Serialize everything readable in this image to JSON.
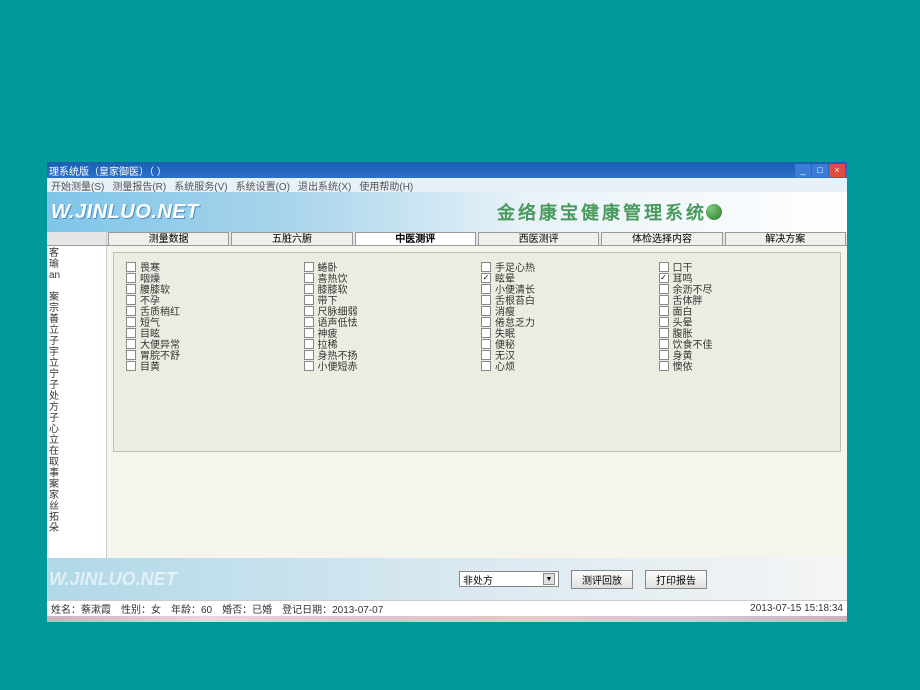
{
  "titlebar": {
    "title": "理系统版（皇家御医）（  ）"
  },
  "menubar": {
    "items": [
      "开始测量(S)",
      "测量报告(R)",
      "系统服务(V)",
      "系统设置(O)",
      "退出系统(X)",
      "使用帮助(H)"
    ]
  },
  "banner": {
    "url": "W.JINLUO.NET",
    "title": "金络康宝健康管理系统"
  },
  "tabs": {
    "items": [
      {
        "label": "测量数据",
        "active": false
      },
      {
        "label": "五脏六腑",
        "active": false
      },
      {
        "label": "中医测评",
        "active": true
      },
      {
        "label": "西医测评",
        "active": false
      },
      {
        "label": "体检选择内容",
        "active": false
      },
      {
        "label": "解决方案",
        "active": false
      }
    ]
  },
  "sidebar": {
    "text": "客\n瑜\nan\n\n案\n宗\n善\n立\n子\n宇\n立\n宁\n子\n处\n方\n子\n心\n立\n在\n取\n事\n案\n家\n丝\n拓\n朵"
  },
  "symptoms": {
    "col1": [
      {
        "label": "畏寒",
        "checked": false
      },
      {
        "label": "咽燥",
        "checked": false
      },
      {
        "label": "腰膝软",
        "checked": false
      },
      {
        "label": "不孕",
        "checked": false
      },
      {
        "label": "舌质稍红",
        "checked": false
      },
      {
        "label": "短气",
        "checked": false
      },
      {
        "label": "目眩",
        "checked": false
      },
      {
        "label": "大便异常",
        "checked": false
      },
      {
        "label": "胃脘不舒",
        "checked": false
      },
      {
        "label": "目黄",
        "checked": false
      }
    ],
    "col2": [
      {
        "label": "蜷卧",
        "checked": false
      },
      {
        "label": "喜热饮",
        "checked": false
      },
      {
        "label": "膝膝软",
        "checked": false
      },
      {
        "label": "带下",
        "checked": false
      },
      {
        "label": "尺脉细弱",
        "checked": false
      },
      {
        "label": "语声低怯",
        "checked": false
      },
      {
        "label": "神疲",
        "checked": false
      },
      {
        "label": "拉稀",
        "checked": false
      },
      {
        "label": "身热不扬",
        "checked": false
      },
      {
        "label": "小便短赤",
        "checked": false
      }
    ],
    "col3": [
      {
        "label": "手足心热",
        "checked": false
      },
      {
        "label": "眩晕",
        "checked": true
      },
      {
        "label": "小便清长",
        "checked": false
      },
      {
        "label": "舌根苔白",
        "checked": false
      },
      {
        "label": "消瘦",
        "checked": false
      },
      {
        "label": "倦怠乏力",
        "checked": false
      },
      {
        "label": "失眠",
        "checked": false
      },
      {
        "label": "便秘",
        "checked": false
      },
      {
        "label": "无汉",
        "checked": false
      },
      {
        "label": "心烦",
        "checked": false
      }
    ],
    "col4": [
      {
        "label": "口干",
        "checked": false
      },
      {
        "label": "耳鸣",
        "checked": true
      },
      {
        "label": "余沥不尽",
        "checked": false
      },
      {
        "label": "舌体胖",
        "checked": false
      },
      {
        "label": "面白",
        "checked": false
      },
      {
        "label": "头晕",
        "checked": false
      },
      {
        "label": "腹胀",
        "checked": false
      },
      {
        "label": "饮食不佳",
        "checked": false
      },
      {
        "label": "身黄",
        "checked": false
      },
      {
        "label": "懊侬",
        "checked": false
      }
    ]
  },
  "footer": {
    "url": "W.JINLUO.NET",
    "combo_value": "非处方",
    "btn_replay": "测评回放",
    "btn_print": "打印报告"
  },
  "statusbar": {
    "patient": "姓名：蔡漱霞　性别：女　年龄：60　婚否：已婚　登记日期：2013-07-07",
    "datetime": "2013-07-15 15:18:34"
  }
}
